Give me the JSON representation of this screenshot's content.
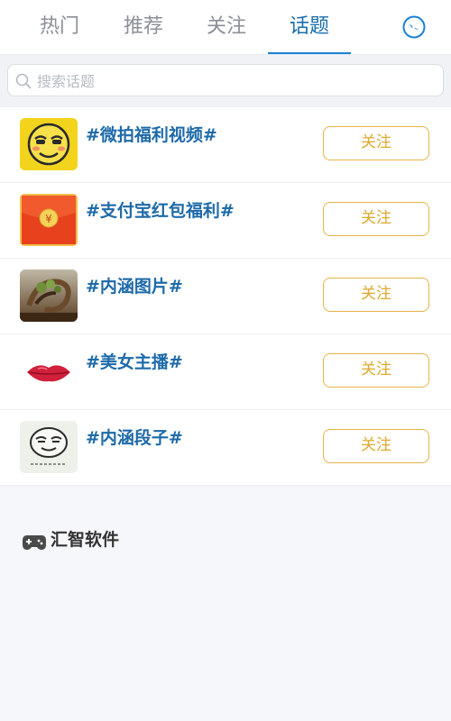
{
  "tabs": [
    {
      "label": "热门",
      "active": false
    },
    {
      "label": "推荐",
      "active": false
    },
    {
      "label": "关注",
      "active": false
    },
    {
      "label": "话题",
      "active": true
    }
  ],
  "search": {
    "placeholder": "搜索话题"
  },
  "topics": [
    {
      "title": "#微拍福利视频#",
      "follow_label": "关注",
      "icon": "yellow-smiley-icon"
    },
    {
      "title": "#支付宝红包福利#",
      "follow_label": "关注",
      "icon": "red-envelope-icon"
    },
    {
      "title": "#内涵图片#",
      "follow_label": "关注",
      "icon": "tree-painting-icon"
    },
    {
      "title": "#美女主播#",
      "follow_label": "关注",
      "icon": "red-lips-icon"
    },
    {
      "title": "#内涵段子#",
      "follow_label": "关注",
      "icon": "sketch-face-icon"
    }
  ],
  "brand": {
    "name": "汇智软件",
    "icon": "gamepad-icon"
  },
  "colors": {
    "accent": "#1a83d6",
    "follow_border": "#e8b347",
    "topic_title": "#1e6aa9"
  }
}
